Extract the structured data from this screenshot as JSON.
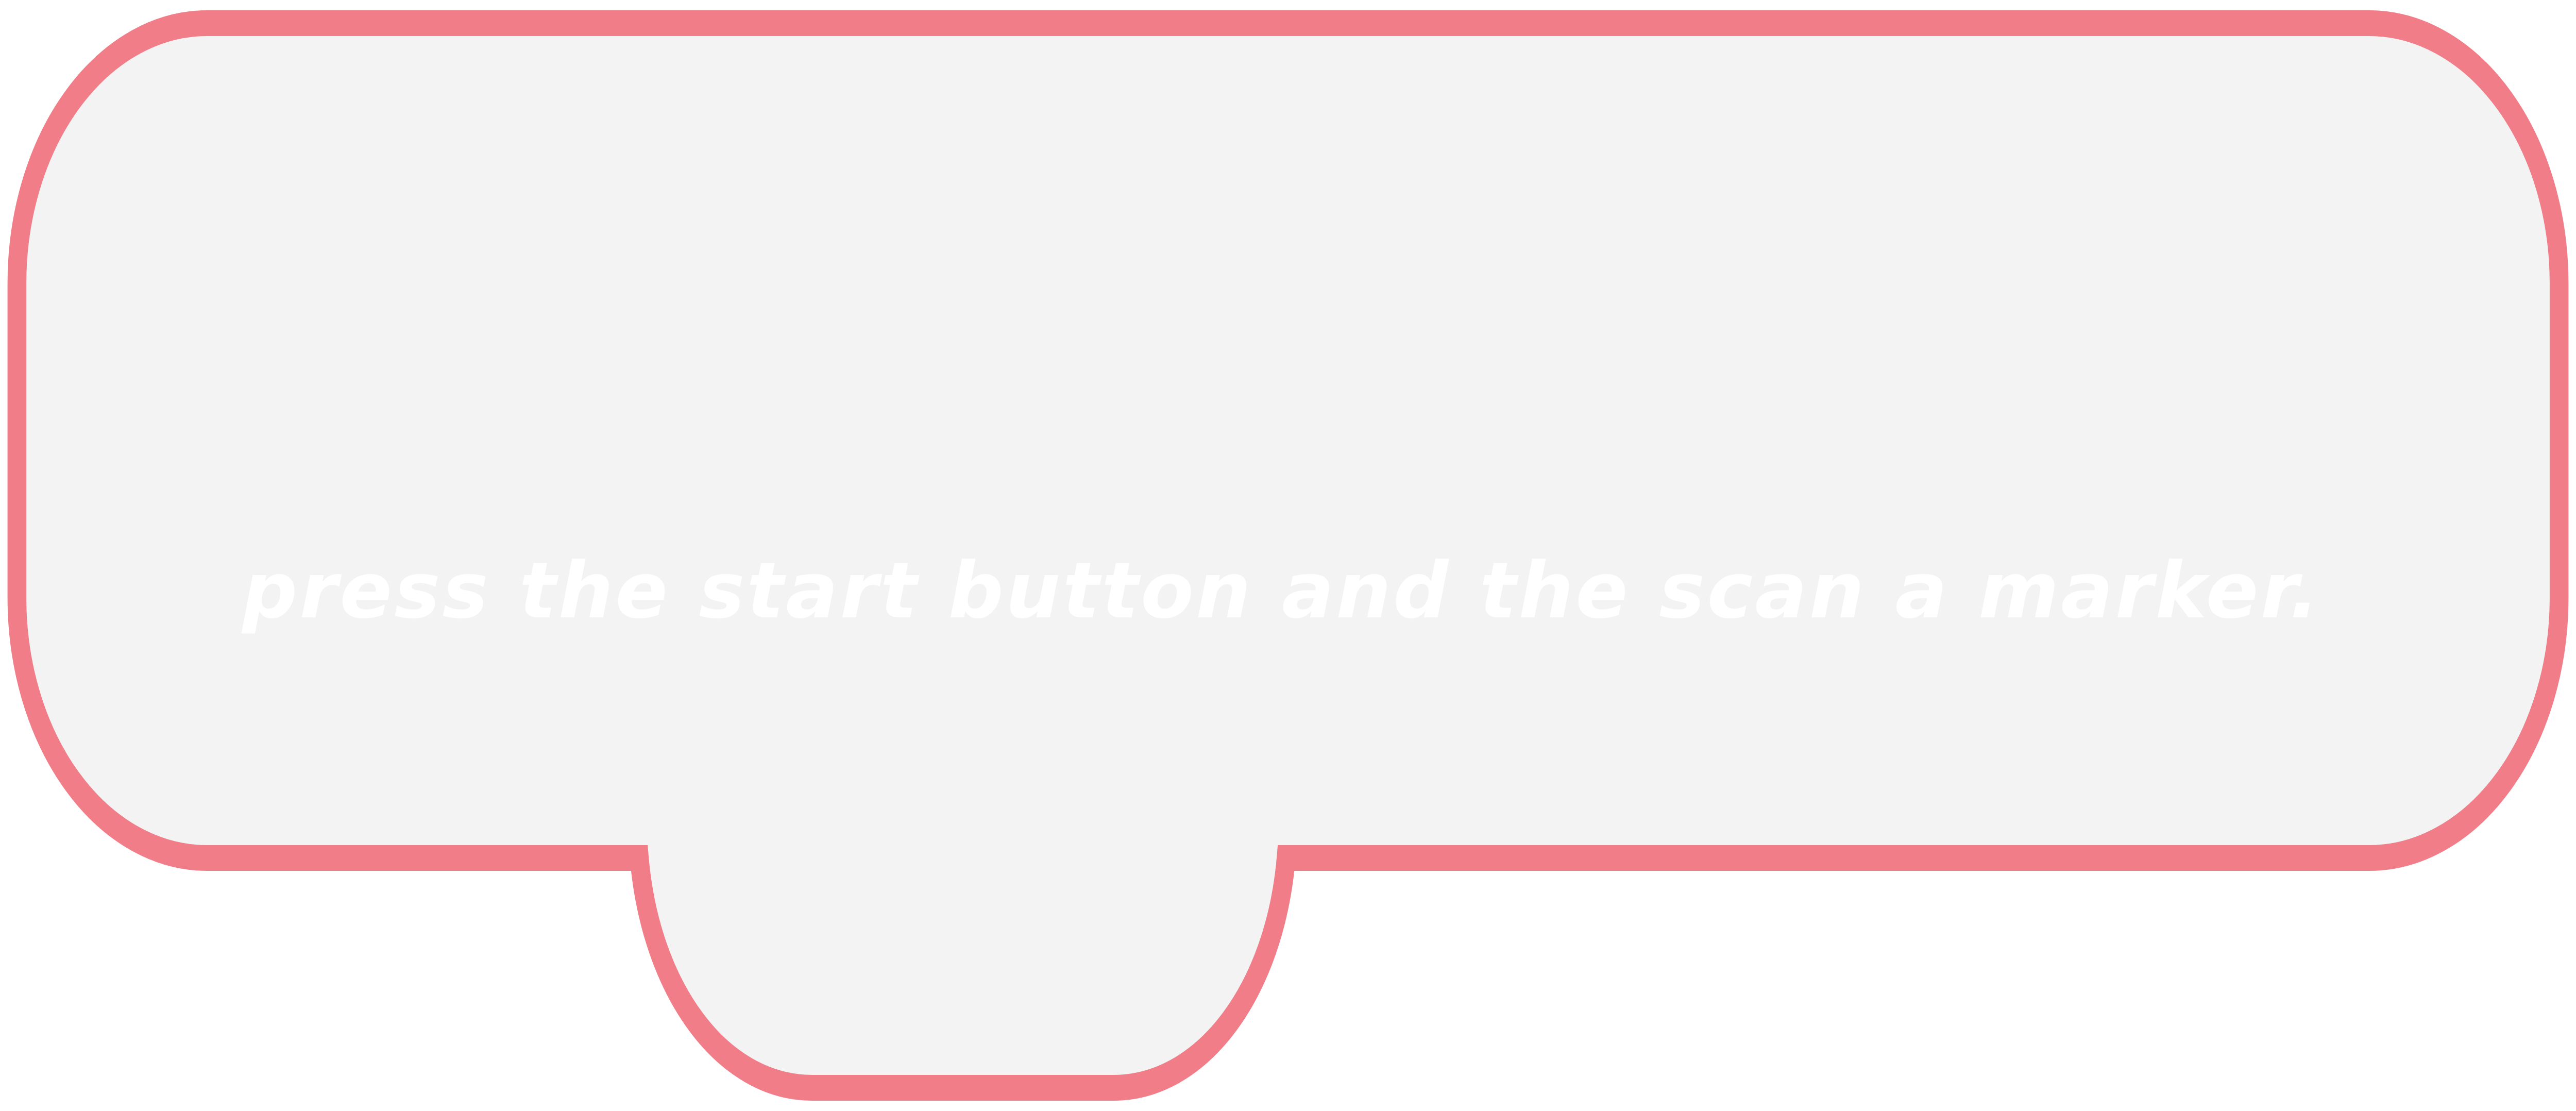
{
  "callout": {
    "text": "press the start button and the scan a marker.",
    "fill_color": "#f3f3f3",
    "border_color": "#f07d87",
    "text_color": "#ffffff"
  }
}
